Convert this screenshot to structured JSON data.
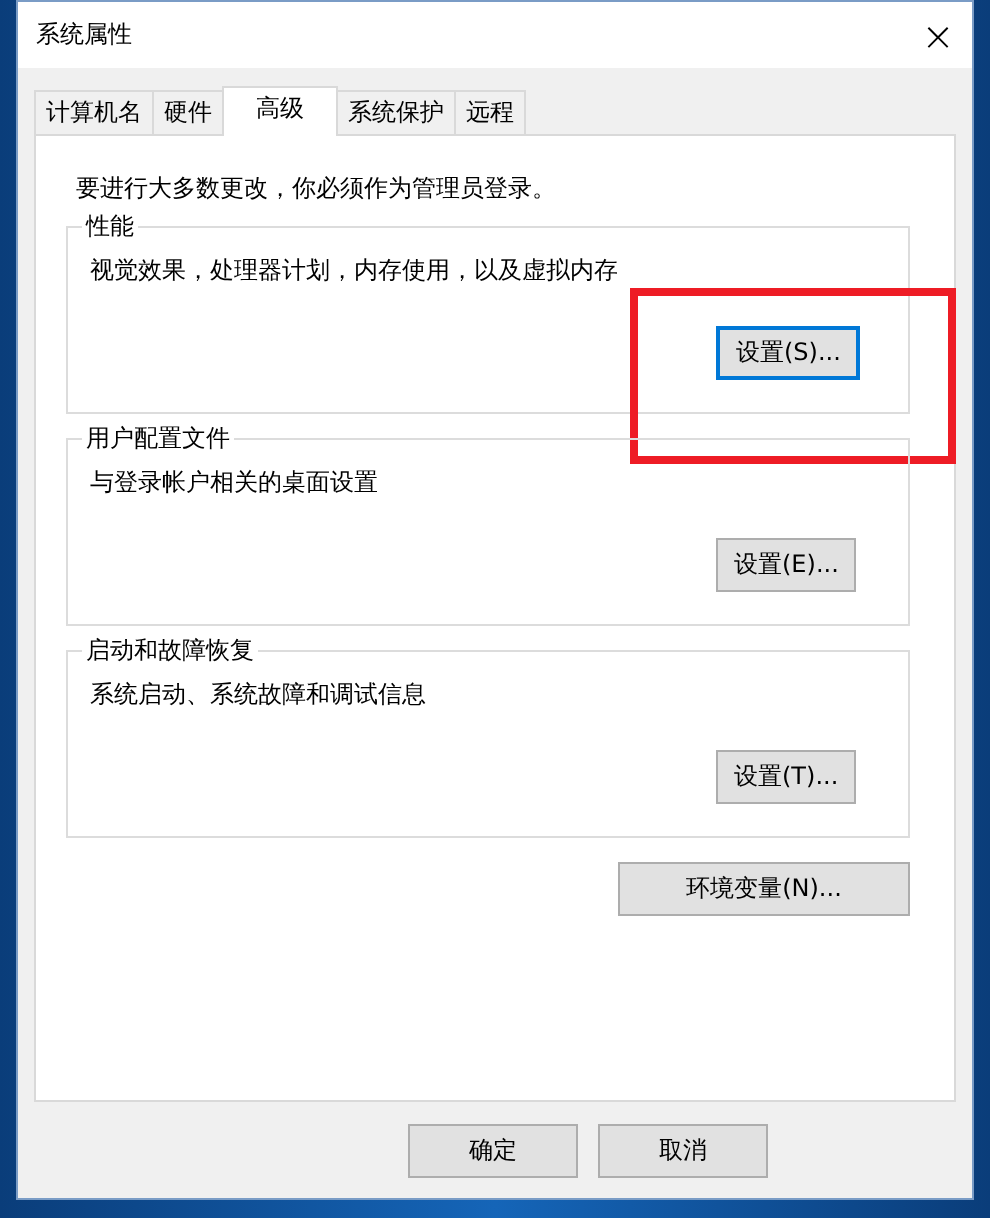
{
  "window": {
    "title": "系统属性",
    "close_glyph": "×"
  },
  "tabs": [
    {
      "label": "计算机名",
      "selected": false
    },
    {
      "label": "硬件",
      "selected": false
    },
    {
      "label": "高级",
      "selected": true
    },
    {
      "label": "系统保护",
      "selected": false
    },
    {
      "label": "远程",
      "selected": false
    }
  ],
  "notice": "要进行大多数更改，你必须作为管理员登录。",
  "groups": [
    {
      "title": "性能",
      "description": "视觉效果，处理器计划，内存使用，以及虚拟内存",
      "button": {
        "label": "设置(S)...",
        "focused": true
      },
      "highlighted": true
    },
    {
      "title": "用户配置文件",
      "description": "与登录帐户相关的桌面设置",
      "button": {
        "label": "设置(E)...",
        "focused": false
      },
      "highlighted": false
    },
    {
      "title": "启动和故障恢复",
      "description": "系统启动、系统故障和调试信息",
      "button": {
        "label": "设置(T)...",
        "focused": false
      },
      "highlighted": false
    }
  ],
  "environment_button": "环境变量(N)...",
  "footer_buttons": [
    "确定",
    "取消"
  ]
}
